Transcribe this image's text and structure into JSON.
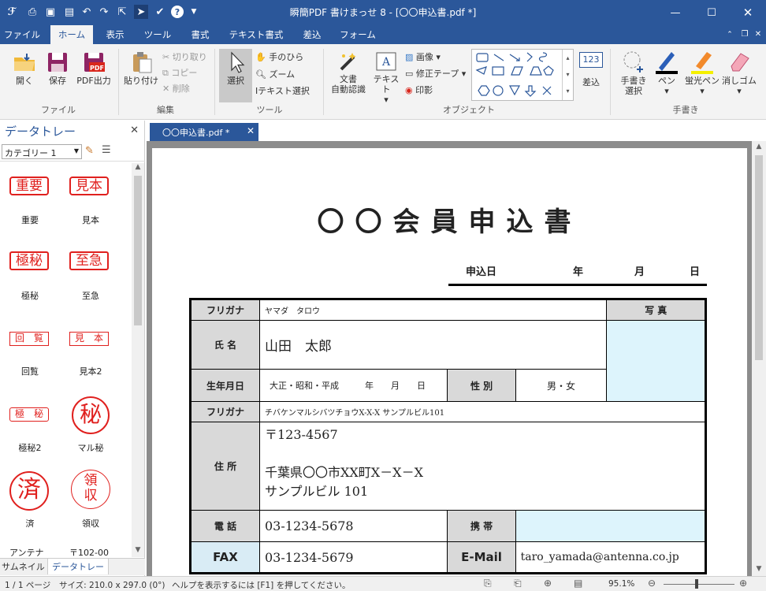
{
  "titlebar": {
    "title": "瞬簡PDF 書けまっせ 8 - [〇〇申込書.pdf *]"
  },
  "menu": [
    "ファイル",
    "ホーム",
    "表示",
    "ツール",
    "書式",
    "テキスト書式",
    "差込",
    "フォーム"
  ],
  "ribbon": {
    "file_group": {
      "open": "開く",
      "save": "保存",
      "pdf_out": "PDF出力",
      "label": "ファイル"
    },
    "edit_group": {
      "paste": "貼り付け",
      "cut": "切り取り",
      "copy": "コピー",
      "delete": "削除",
      "label": "編集"
    },
    "tool_group": {
      "select": "選択",
      "hand": "手のひら",
      "zoom": "ズーム",
      "text_select": "テキスト選択",
      "label": "ツール"
    },
    "object_group": {
      "ocr_l1": "文書",
      "ocr_l2": "自動認識",
      "text": "テキスト",
      "image": "画像",
      "correction_tape": "修正テープ",
      "seal": "印影",
      "label": "オブジェクト"
    },
    "insert_group": {
      "num": "123",
      "label": "差込"
    },
    "hand_group": {
      "select_l1": "手書き",
      "select_l2": "選択",
      "pen": "ペン",
      "highlighter": "蛍光ペン",
      "eraser": "消しゴム",
      "label": "手書き"
    }
  },
  "sidebar": {
    "title": "データトレー",
    "category": "カテゴリー 1",
    "stamps": [
      {
        "text": "重要",
        "label": "重要"
      },
      {
        "text": "見本",
        "label": "見本"
      },
      {
        "text": "極秘",
        "label": "極秘"
      },
      {
        "text": "至急",
        "label": "至急"
      },
      {
        "text": "回　覧",
        "label": "回覧"
      },
      {
        "text": "見　本",
        "label": "見本2"
      },
      {
        "text": "極　秘",
        "label": "極秘2"
      },
      {
        "text": "秘",
        "label": "マル秘"
      },
      {
        "text": "済",
        "label": "済"
      },
      {
        "text": "領収",
        "label": "領収"
      }
    ],
    "partial_items": [
      "アンテナ",
      "〒102-00"
    ],
    "tabs": [
      "サムネイル",
      "データトレー"
    ]
  },
  "document": {
    "tab_label": "〇〇申込書.pdf *",
    "title": "〇〇会員申込書",
    "date_line": {
      "label": "申込日",
      "year": "年",
      "month": "月",
      "day": "日"
    },
    "form": {
      "furigana_label": "フリガナ",
      "furigana_value": "ヤマダ　タロウ",
      "photo_label": "写 真",
      "name_label": "氏 名",
      "name_value": "山田　太郎",
      "birth_label": "生年月日",
      "birth_value": "大正・昭和・平成　　　年　　月　　日",
      "gender_label": "性 別",
      "gender_value": "男・女",
      "addr_furigana_label": "フリガナ",
      "addr_furigana_value": "チバケンマルシバツチョウX-X-X サンプルビル101",
      "addr_label": "住 所",
      "addr_line1": "〒123-4567",
      "addr_line2": "千葉県〇〇市XX町X－X－X",
      "addr_line3": "サンプルビル 101",
      "phone_label": "電 話",
      "phone_value": "03-1234-5678",
      "mobile_label": "携 帯",
      "fax_label": "FAX",
      "fax_value": "03-1234-5679",
      "email_label": "E-Mail",
      "email_value": "taro_yamada@antenna.co.jp"
    }
  },
  "statusbar": {
    "page": "1 / 1 ページ",
    "size": "サイズ: 210.0 x 297.0 (0°)",
    "help": "ヘルプを表示するには [F1] を押してください。",
    "zoom": "95.1%"
  },
  "colors": {
    "accent": "#2b579a",
    "stamp_red": "#e0201e",
    "form_gray": "#d9d9d9",
    "form_blue": "#ddf4fc"
  }
}
